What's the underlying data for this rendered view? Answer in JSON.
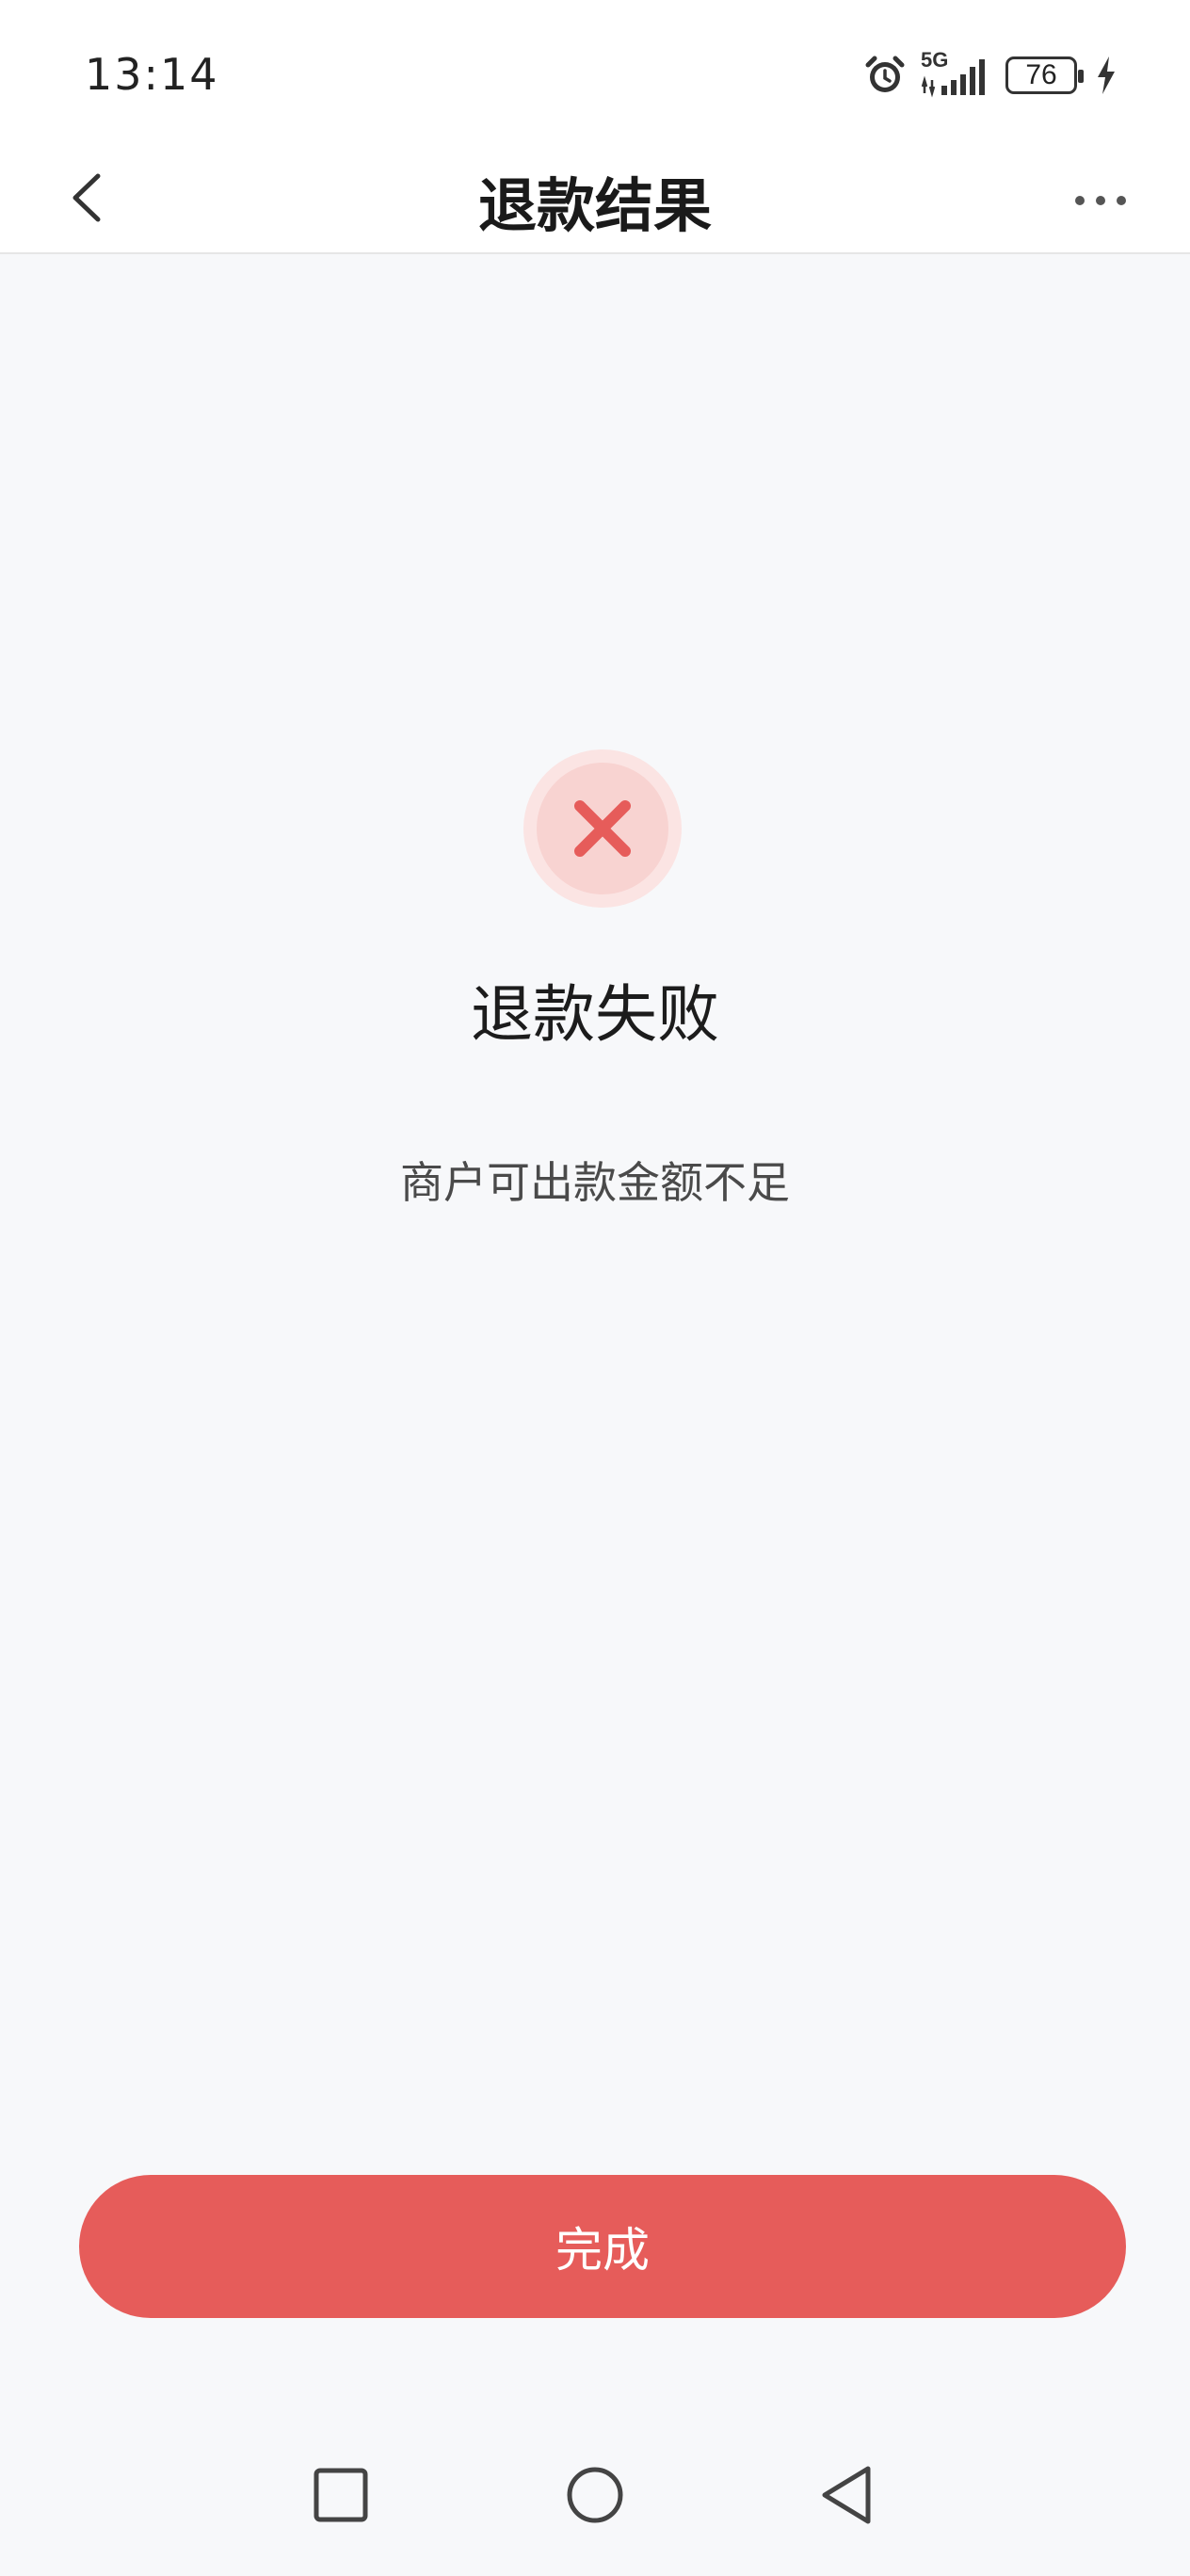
{
  "status_bar": {
    "time": "13:14",
    "network": "5G",
    "battery_level": "76",
    "icons": [
      "alarm-icon",
      "signal-icon",
      "battery-icon",
      "charging-icon"
    ]
  },
  "header": {
    "title": "退款结果",
    "back_icon": "chevron-left-icon",
    "more_icon": "more-dots-icon"
  },
  "result": {
    "icon": "close-icon",
    "title": "退款失败",
    "message": "商户可出款金额不足"
  },
  "actions": {
    "done_label": "完成"
  },
  "colors": {
    "accent": "#e65c5a",
    "icon_ring": "#fbe4e3",
    "icon_inner": "#f8d3d1",
    "page_background": "#f7f8fa"
  },
  "system_nav": {
    "icons": [
      "recent-apps-icon",
      "home-icon",
      "back-icon"
    ]
  }
}
